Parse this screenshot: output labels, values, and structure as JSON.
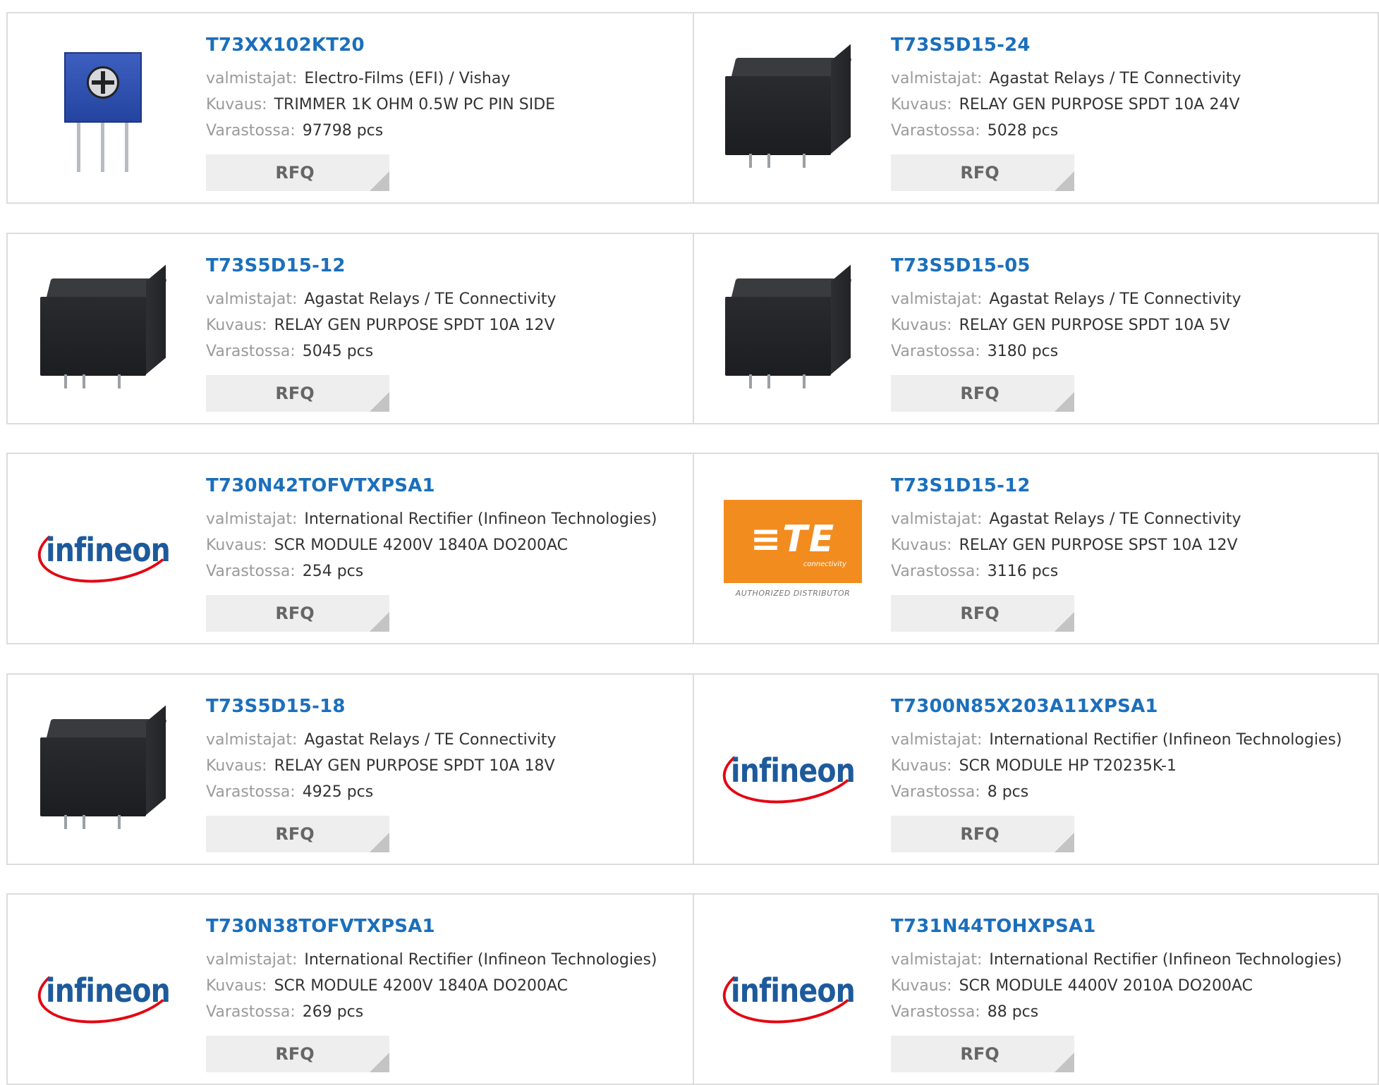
{
  "labels": {
    "manufacturer": "valmistajat:",
    "description": "Kuvaus:",
    "stock": "Varastossa:",
    "rfq": "RFQ"
  },
  "te_logo": {
    "mark": "≡TE",
    "sub": "connectivity",
    "authorized": "AUTHORIZED DISTRIBUTOR"
  },
  "infineon_logo": {
    "word": "infineon"
  },
  "products": [
    {
      "part": "T73XX102KT20",
      "manufacturer": "Electro-Films (EFI) / Vishay",
      "description": "TRIMMER 1K OHM 0.5W PC PIN SIDE",
      "stock": "97798 pcs",
      "image": "trimmer-potentiometer"
    },
    {
      "part": "T73S5D15-24",
      "manufacturer": "Agastat Relays / TE Connectivity",
      "description": "RELAY GEN PURPOSE SPDT 10A 24V",
      "stock": "5028 pcs",
      "image": "relay"
    },
    {
      "part": "T73S5D15-12",
      "manufacturer": "Agastat Relays / TE Connectivity",
      "description": "RELAY GEN PURPOSE SPDT 10A 12V",
      "stock": "5045 pcs",
      "image": "relay"
    },
    {
      "part": "T73S5D15-05",
      "manufacturer": "Agastat Relays / TE Connectivity",
      "description": "RELAY GEN PURPOSE SPDT 10A 5V",
      "stock": "3180 pcs",
      "image": "relay"
    },
    {
      "part": "T730N42TOFVTXPSA1",
      "manufacturer": "International Rectifier (Infineon Technologies)",
      "description": "SCR MODULE 4200V 1840A DO200AC",
      "stock": "254 pcs",
      "image": "infineon-logo"
    },
    {
      "part": "T73S1D15-12",
      "manufacturer": "Agastat Relays / TE Connectivity",
      "description": "RELAY GEN PURPOSE SPST 10A 12V",
      "stock": "3116 pcs",
      "image": "te-connectivity-logo"
    },
    {
      "part": "T73S5D15-18",
      "manufacturer": "Agastat Relays / TE Connectivity",
      "description": "RELAY GEN PURPOSE SPDT 10A 18V",
      "stock": "4925 pcs",
      "image": "relay"
    },
    {
      "part": "T7300N85X203A11XPSA1",
      "manufacturer": "International Rectifier (Infineon Technologies)",
      "description": "SCR MODULE HP T20235K-1",
      "stock": "8 pcs",
      "image": "infineon-logo"
    },
    {
      "part": "T730N38TOFVTXPSA1",
      "manufacturer": "International Rectifier (Infineon Technologies)",
      "description": "SCR MODULE 4200V 1840A DO200AC",
      "stock": "269 pcs",
      "image": "infineon-logo"
    },
    {
      "part": "T731N44TOHXPSA1",
      "manufacturer": "International Rectifier (Infineon Technologies)",
      "description": "SCR MODULE 4400V 2010A DO200AC",
      "stock": "88 pcs",
      "image": "infineon-logo"
    }
  ]
}
